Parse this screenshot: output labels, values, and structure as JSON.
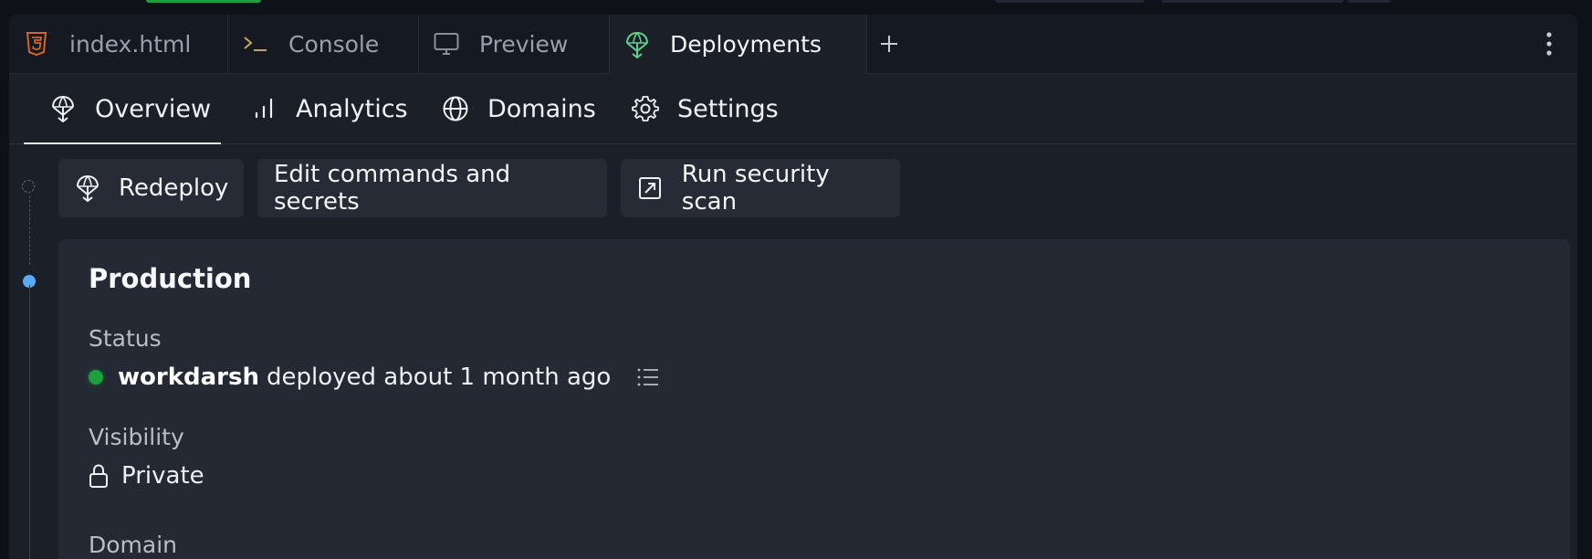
{
  "tabs": [
    {
      "label": "index.html",
      "icon": "html5-icon"
    },
    {
      "label": "Console",
      "icon": "terminal-icon"
    },
    {
      "label": "Preview",
      "icon": "monitor-icon"
    },
    {
      "label": "Deployments",
      "icon": "deployments-icon",
      "active": true
    }
  ],
  "subnav": [
    {
      "label": "Overview",
      "icon": "deploy-icon",
      "active": true
    },
    {
      "label": "Analytics",
      "icon": "bar-chart-icon"
    },
    {
      "label": "Domains",
      "icon": "globe-icon"
    },
    {
      "label": "Settings",
      "icon": "gear-icon"
    }
  ],
  "actions": {
    "redeploy": "Redeploy",
    "edit": "Edit commands and secrets",
    "scan": "Run security scan"
  },
  "card": {
    "title": "Production",
    "status_label": "Status",
    "user": "workdarsh",
    "status_text": "deployed about 1 month ago",
    "visibility_label": "Visibility",
    "visibility_value": "Private",
    "domain_label": "Domain"
  },
  "colors": {
    "status_ok": "#1aa13c",
    "timeline_active": "#5aa9f8",
    "html_icon": "#d0662c",
    "terminal_icon": "#c9a45c",
    "deploy_icon": "#5fd08a"
  }
}
